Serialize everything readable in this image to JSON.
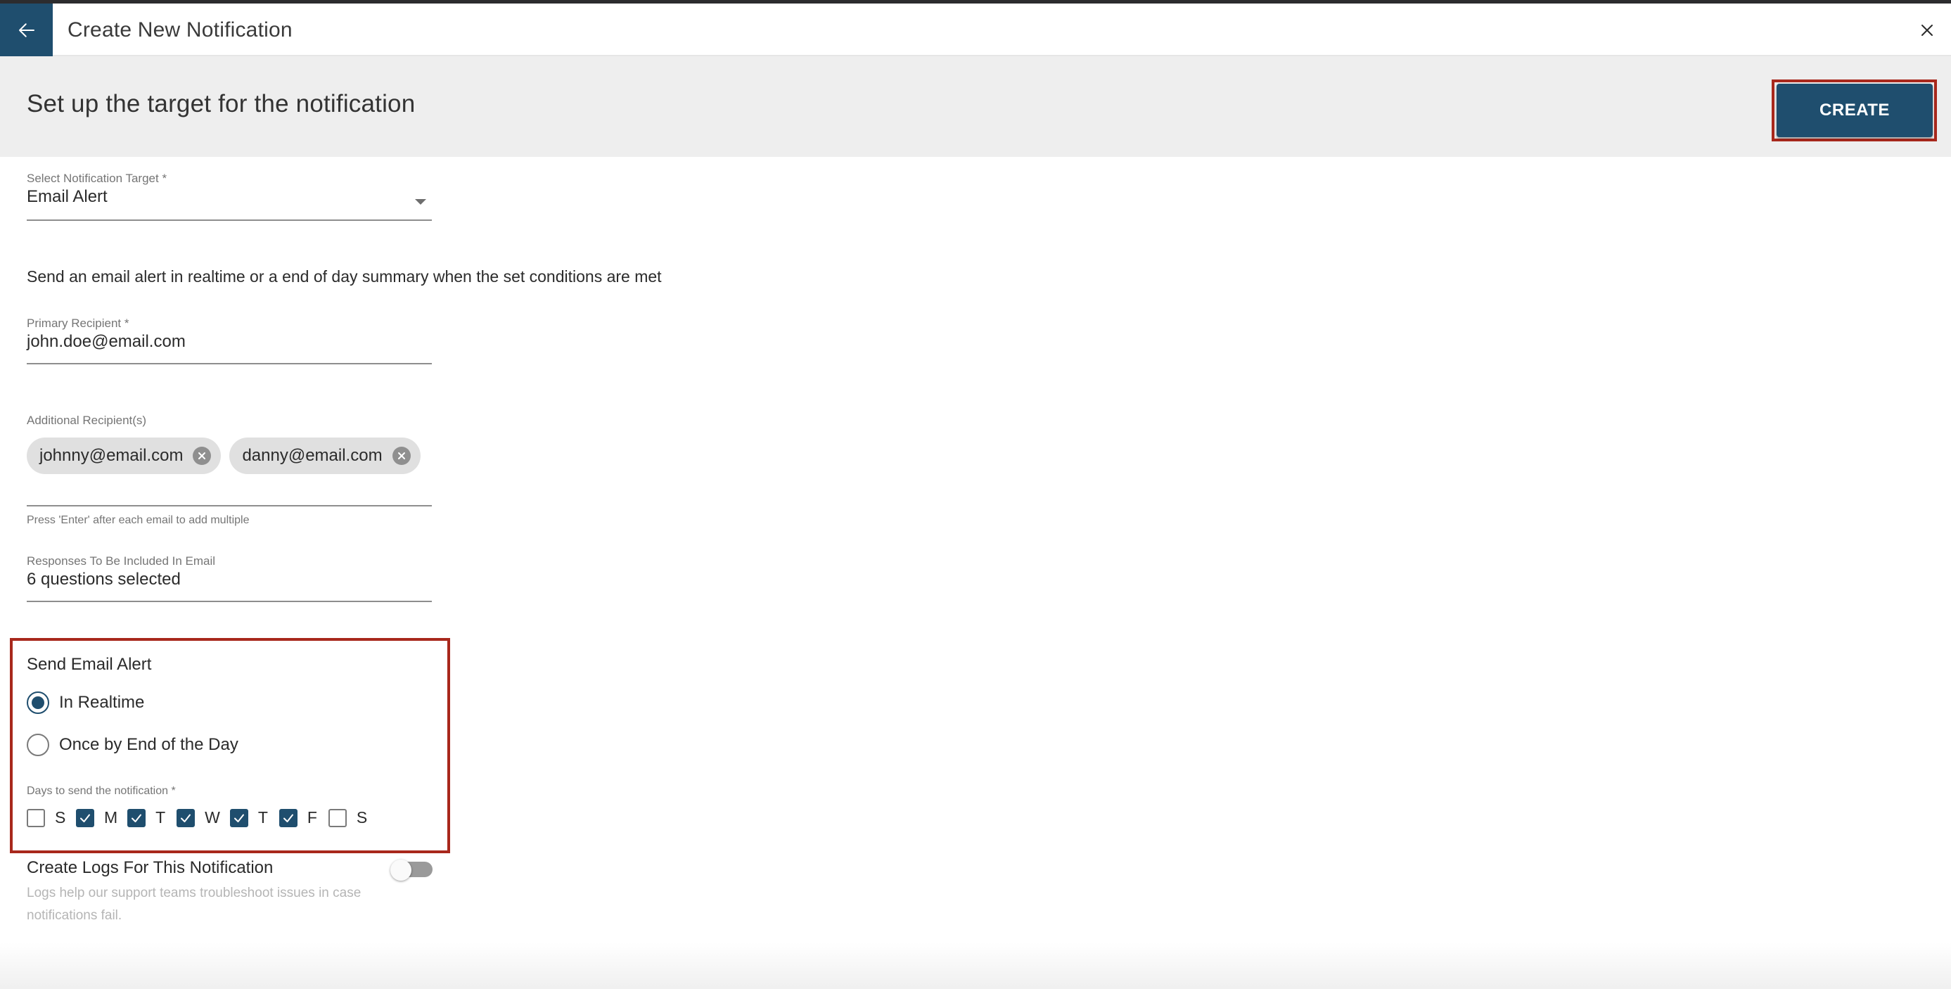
{
  "window": {
    "title": "Create New Notification",
    "back_icon": "arrow-left-icon",
    "close_icon": "close-icon"
  },
  "header": {
    "heading": "Set up the target for the notification",
    "create_label": "CREATE"
  },
  "target_select": {
    "label": "Select Notification Target *",
    "value": "Email Alert",
    "icon": "dropdown-arrow-icon"
  },
  "description": "Send an email alert in realtime or a end of day summary when the set conditions are met",
  "primary_recipient": {
    "label": "Primary Recipient *",
    "value": "john.doe@email.com"
  },
  "additional_recipients": {
    "label": "Additional Recipient(s)",
    "chips": [
      {
        "label": "johnny@email.com"
      },
      {
        "label": "danny@email.com"
      }
    ],
    "input_value": "",
    "helper": "Press 'Enter' after each email to add multiple"
  },
  "responses": {
    "label": "Responses To Be Included In Email",
    "value": "6 questions selected"
  },
  "send_alert": {
    "title": "Send Email Alert",
    "options": [
      {
        "label": "In Realtime",
        "selected": true
      },
      {
        "label": "Once by End of the Day",
        "selected": false
      }
    ],
    "days_label": "Days to send the notification *",
    "days": [
      {
        "letter": "S",
        "checked": false
      },
      {
        "letter": "M",
        "checked": true
      },
      {
        "letter": "T",
        "checked": true
      },
      {
        "letter": "W",
        "checked": true
      },
      {
        "letter": "T",
        "checked": true
      },
      {
        "letter": "F",
        "checked": true
      },
      {
        "letter": "S",
        "checked": false
      }
    ]
  },
  "logs": {
    "title": "Create Logs For This Notification",
    "description": "Logs help our support teams troubleshoot issues in case notifications fail.",
    "enabled": false
  },
  "colors": {
    "primary": "#1f4e6e",
    "highlight_outline": "#a8281c",
    "band_background": "#eeeeee"
  }
}
